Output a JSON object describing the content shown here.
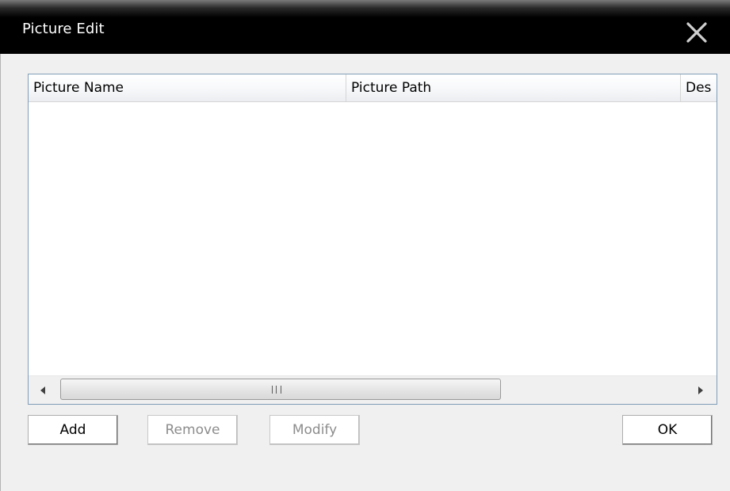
{
  "window": {
    "title": "Picture Edit",
    "close_icon": "close-icon"
  },
  "list": {
    "columns": [
      {
        "label": "Picture Name"
      },
      {
        "label": "Picture Path"
      },
      {
        "label": "Des"
      }
    ],
    "rows": []
  },
  "scrollbar": {
    "left_icon": "scroll-left-arrow-icon",
    "right_icon": "scroll-right-arrow-icon",
    "grip_icon": "grip-icon"
  },
  "buttons": {
    "add_label": "Add",
    "remove_label": "Remove",
    "modify_label": "Modify",
    "ok_label": "OK"
  },
  "colors": {
    "titlebar": "#000000",
    "title_text": "#ffffff",
    "disabled_text": "#8c8c8c"
  }
}
